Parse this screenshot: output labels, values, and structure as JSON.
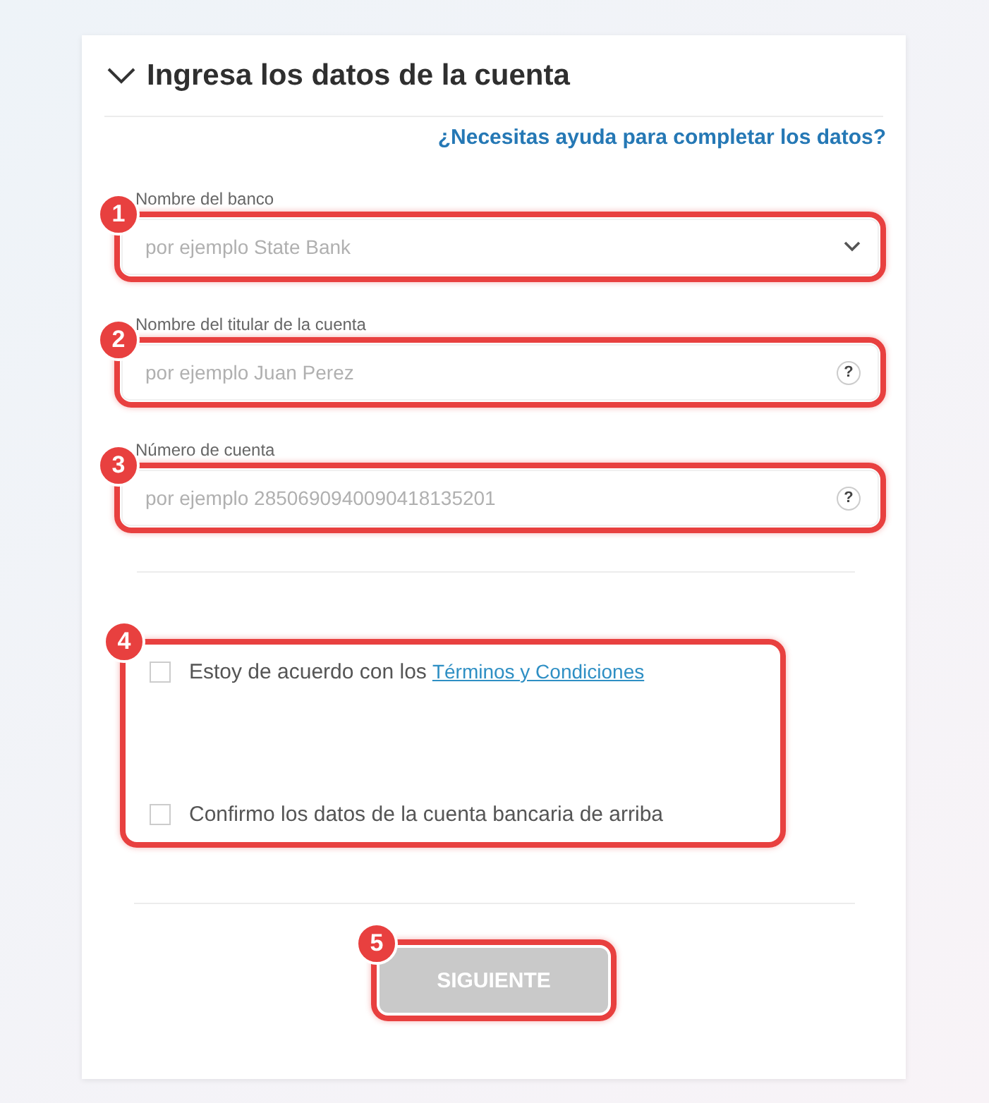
{
  "section": {
    "title": "Ingresa los datos de la cuenta",
    "expanded": true
  },
  "help_link": "¿Necesitas ayuda para completar los datos?",
  "fields": [
    {
      "kind": "select",
      "label": "Nombre del banco",
      "placeholder": "por ejemplo State Bank",
      "marker": "1"
    },
    {
      "kind": "text",
      "label": "Nombre del titular de la cuenta",
      "placeholder": "por ejemplo Juan Perez",
      "help": "?",
      "marker": "2"
    },
    {
      "kind": "text",
      "label": "Número de cuenta",
      "placeholder": "por ejemplo 2850690940090418135201",
      "help": "?",
      "marker": "3"
    }
  ],
  "agreements": {
    "marker": "4",
    "items": [
      {
        "text": "Estoy de acuerdo con los",
        "link": "Términos y Condiciones",
        "checked": false
      },
      {
        "text": "Confirmo los datos de la cuenta bancaria de arriba",
        "checked": false
      }
    ]
  },
  "button": {
    "label": "SIGUIENTE",
    "disabled": true,
    "marker": "5"
  }
}
